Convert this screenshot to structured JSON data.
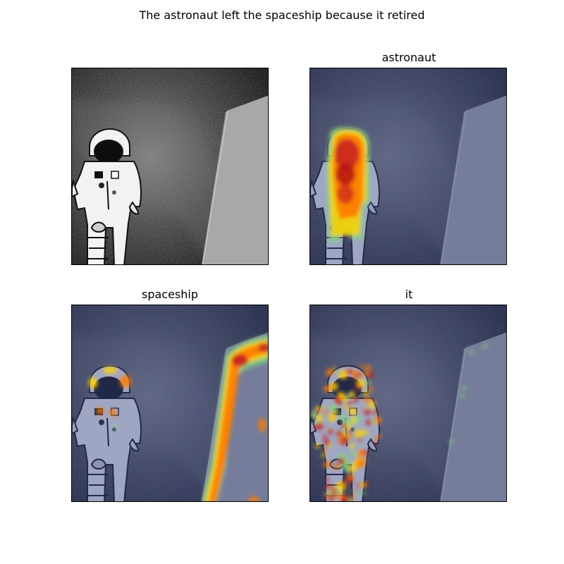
{
  "figure": {
    "title": "The astronaut left the spaceship because it retired",
    "panels": [
      {
        "id": "original",
        "label": "",
        "style": "grayscale"
      },
      {
        "id": "astronaut",
        "label": "astronaut",
        "style": "heatmap-astronaut"
      },
      {
        "id": "spaceship",
        "label": "spaceship",
        "style": "heatmap-spaceship"
      },
      {
        "id": "it",
        "label": "it",
        "style": "heatmap-it"
      }
    ]
  },
  "colors": {
    "heat_high": "#c81e1e",
    "heat_mid": "#ff7a00",
    "heat_low": "#ffd400",
    "heat_edge": "#7fd27f",
    "tint_blue": "#3a4a8a"
  }
}
